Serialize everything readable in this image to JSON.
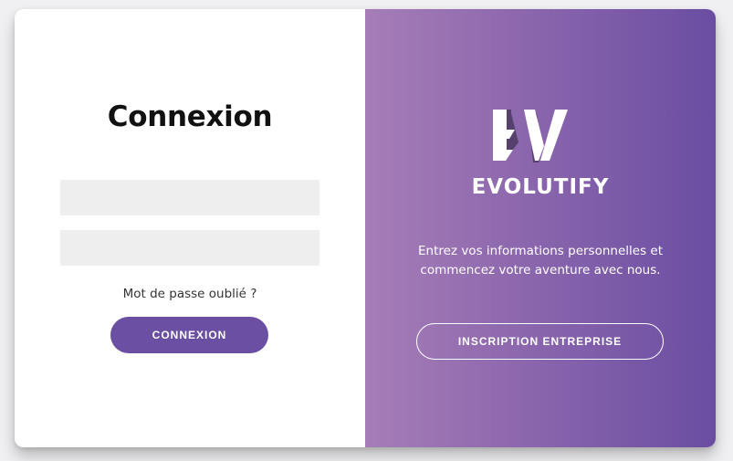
{
  "login": {
    "title": "Connexion",
    "email_value": "",
    "password_value": "",
    "forgot_password": "Mot de passe oublié ?",
    "submit_label": "CONNEXION"
  },
  "signup_panel": {
    "brand_name": "EVOLUTIFY",
    "logo_icon": "evolutify-ev-logo",
    "description_line1": "Entrez vos informations personnelles et",
    "description_line2": "commencez votre aventure avec nous.",
    "signup_label": "INSCRIPTION ENTREPRISE"
  },
  "colors": {
    "page_background": "#f0f0f2",
    "primary_button": "#6a4fa3",
    "gradient_start": "#a67db7",
    "gradient_end": "#6a4da2",
    "input_background": "#eeeeee"
  }
}
